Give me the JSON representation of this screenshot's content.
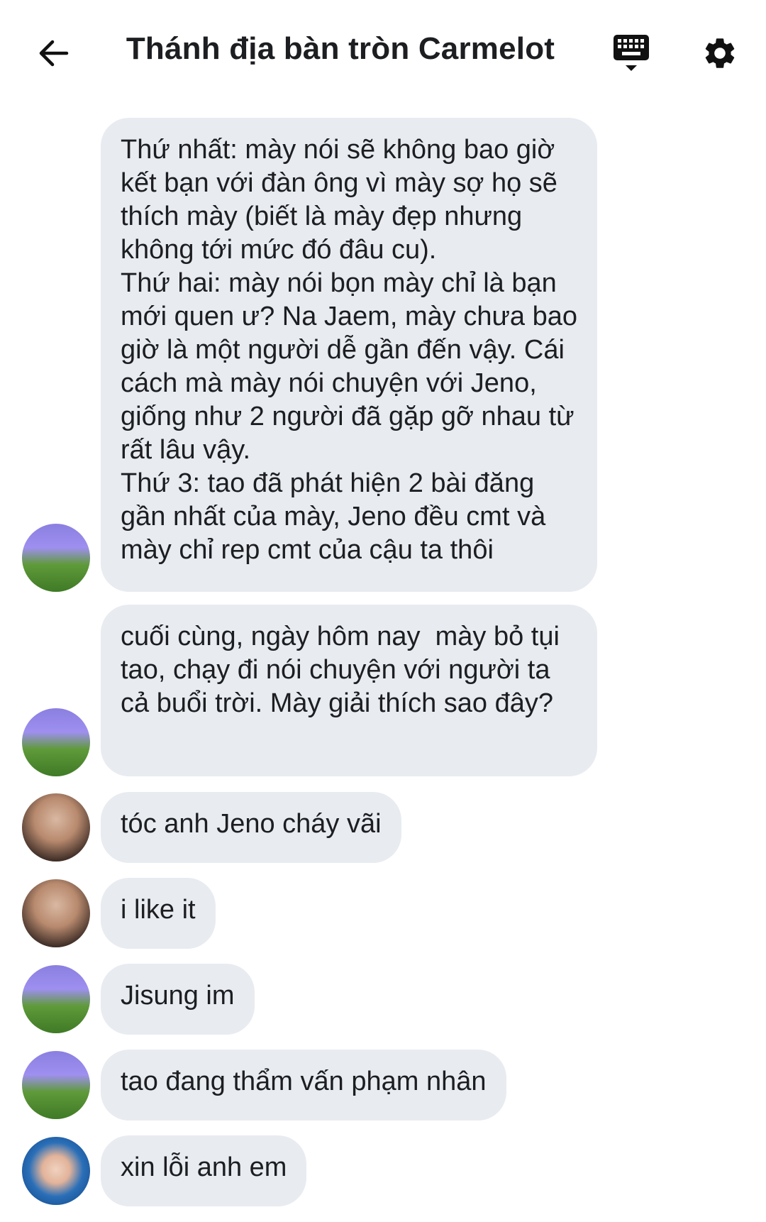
{
  "header": {
    "title": "Thánh địa bàn tròn Carmelot",
    "back_icon": "back-arrow-icon",
    "keyboard_icon": "keyboard-icon",
    "settings_icon": "gear-icon"
  },
  "messages": [
    {
      "text": "Thứ nhất: mày nói sẽ không bao giờ kết bạn với đàn ông vì mày sợ họ sẽ thích mày (biết là mày đẹp nhưng không tới mức đó đâu cu).\nThứ hai: mày nói bọn mày chỉ là bạn mới quen ư? Na Jaem, mày chưa bao giờ là một người dễ gần đến vậy. Cái cách mà mày nói chuyện với Jeno, giống như 2 người đã gặp gỡ nhau từ rất lâu vậy.\nThứ 3: tao đã phát hiện 2 bài đăng gần nhất của mày, Jeno đều cmt và mày chỉ rep cmt của cậu ta thôi",
      "avatar": "purple-field-avatar"
    },
    {
      "text": "cuối cùng, ngày hôm nay  mày bỏ tụi tao, chạy đi nói chuyện với người ta cả buổi trời. Mày giải thích sao đây?",
      "avatar": "purple-field-avatar"
    },
    {
      "text": "tóc anh Jeno cháy vãi",
      "avatar": "brown-hair-avatar"
    },
    {
      "text": "i like it",
      "avatar": "brown-hair-avatar"
    },
    {
      "text": "Jisung im",
      "avatar": "purple-field-avatar"
    },
    {
      "text": "tao đang thẩm vấn phạm nhân",
      "avatar": "purple-field-avatar"
    },
    {
      "text": "xin lỗi anh em",
      "avatar": "blue-hair-avatar"
    }
  ]
}
